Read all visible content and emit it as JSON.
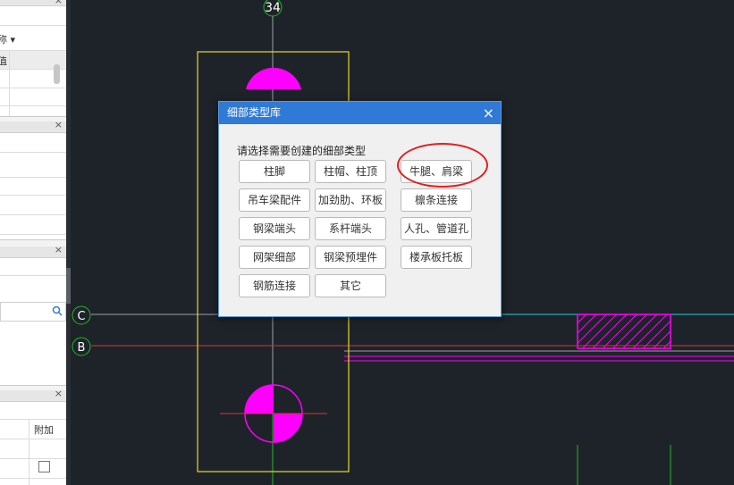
{
  "left_panel": {
    "pane1_label": "",
    "pane2_label": "",
    "pane3_label": "",
    "pane4_column_label": "附加",
    "close_glyph": "×",
    "pane1_col_label": "值",
    "pane1_dropdown_char": "称 ▾"
  },
  "canvas": {
    "axis_labels": [
      "34",
      "C",
      "B"
    ],
    "colors": {
      "yellow": "#e6d92a",
      "magenta": "#ff00ff",
      "cyan": "#22d3d3",
      "red": "#e03030",
      "green": "#22b822",
      "grey": "#9aa0a6"
    }
  },
  "dialog": {
    "title": "细部类型库",
    "close_glyph": "×",
    "prompt": "请选择需要创建的细部类型",
    "buttons": [
      {
        "label": "柱脚"
      },
      {
        "label": "柱帽、柱顶"
      },
      {
        "label": "牛腿、肩梁"
      },
      {
        "label": "吊车梁配件"
      },
      {
        "label": "加劲肋、环板"
      },
      {
        "label": "檩条连接"
      },
      {
        "label": "钢梁端头"
      },
      {
        "label": "系杆端头"
      },
      {
        "label": "人孔、管道孔"
      },
      {
        "label": "网架细部"
      },
      {
        "label": "钢梁预埋件"
      },
      {
        "label": "楼承板托板"
      },
      {
        "label": "钢筋连接"
      },
      {
        "label": "其它"
      }
    ],
    "highlighted_button": "牛腿、肩梁",
    "highlight_color": "#e02020"
  }
}
